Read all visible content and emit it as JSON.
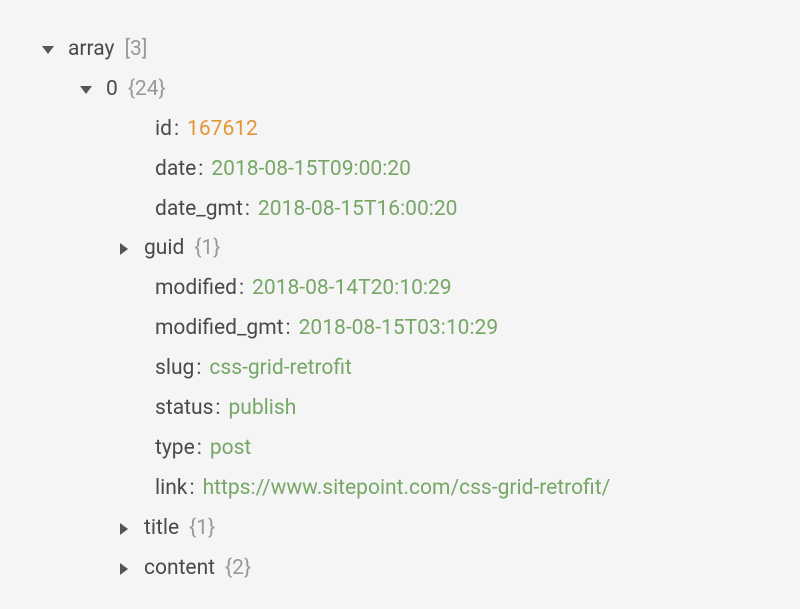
{
  "tree": {
    "root": {
      "key": "array",
      "count": "[3]"
    },
    "index0": {
      "key": "0",
      "count": "{24}"
    },
    "id": {
      "key": "id",
      "value": "167612"
    },
    "date": {
      "key": "date",
      "value": "2018-08-15T09:00:20"
    },
    "date_gmt": {
      "key": "date_gmt",
      "value": "2018-08-15T16:00:20"
    },
    "guid": {
      "key": "guid",
      "count": "{1}"
    },
    "modified": {
      "key": "modified",
      "value": "2018-08-14T20:10:29"
    },
    "modified_gmt": {
      "key": "modified_gmt",
      "value": "2018-08-15T03:10:29"
    },
    "slug": {
      "key": "slug",
      "value": "css-grid-retrofit"
    },
    "status": {
      "key": "status",
      "value": "publish"
    },
    "type": {
      "key": "type",
      "value": "post"
    },
    "link": {
      "key": "link",
      "value": "https://www.sitepoint.com/css-grid-retrofit/"
    },
    "title": {
      "key": "title",
      "count": "{1}"
    },
    "content": {
      "key": "content",
      "count": "{2}"
    }
  }
}
